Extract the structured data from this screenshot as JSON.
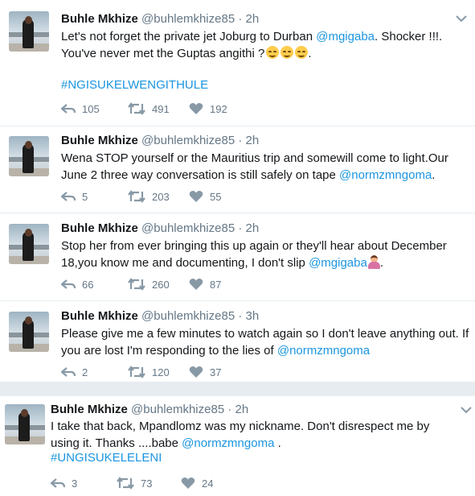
{
  "colors": {
    "link": "#1b95e0",
    "muted": "#657786",
    "text": "#14171a",
    "background": "#e6ecf0"
  },
  "tweets": [
    {
      "name": "Buhle Mkhize",
      "handle": "@buhlemkhize85",
      "dot": "·",
      "time": "2h",
      "text_parts": [
        "Let's not forget the private jet Joburg to Durban ",
        "@mgigaba",
        ". Shocker !!!. You've never met the Guptas angithi ?"
      ],
      "emoji": [
        "smiling-face-emoji",
        "smiling-face-emoji",
        "smiling-face-emoji"
      ],
      "hashtag": "#NGISUKELWENGITHULE",
      "replies": "105",
      "retweets": "491",
      "likes": "192"
    },
    {
      "name": "Buhle Mkhize",
      "handle": "@buhlemkhize85",
      "dot": "·",
      "time": "2h",
      "text_parts": [
        "Wena STOP yourself or the Mauritius trip and somewill come to light.Our June 2 three way conversation is still safely on tape ",
        "@normzmngoma",
        "."
      ],
      "replies": "5",
      "retweets": "203",
      "likes": "55"
    },
    {
      "name": "Buhle Mkhize",
      "handle": "@buhlemkhize85",
      "dot": "·",
      "time": "2h",
      "text_parts": [
        "Stop her from ever bringing this up again or they'll hear about December 18,you know me and documenting, I don't slip ",
        "@mgigaba",
        "."
      ],
      "emoji": [
        "person-gesturing-no-emoji"
      ],
      "replies": "66",
      "retweets": "260",
      "likes": "87"
    },
    {
      "name": "Buhle Mkhize",
      "handle": "@buhlemkhize85",
      "dot": "·",
      "time": "3h",
      "text_parts": [
        "Please give me a few minutes to watch again so I don't leave anything out. If you are lost I'm responding to the lies of ",
        "@normzmngoma",
        ""
      ],
      "replies": "2",
      "retweets": "120",
      "likes": "37"
    },
    {
      "name": "Buhle Mkhize",
      "handle": "@buhlemkhize85",
      "dot": "·",
      "time": "2h",
      "text_parts": [
        "I take that back, Mpandlomz was my nickname. Don't disrespect me by using it. Thanks ....babe ",
        "@normzmngoma",
        " ."
      ],
      "hashtag": "#UNGISUKELELENI",
      "replies": "3",
      "retweets": "73",
      "likes": "24"
    }
  ]
}
